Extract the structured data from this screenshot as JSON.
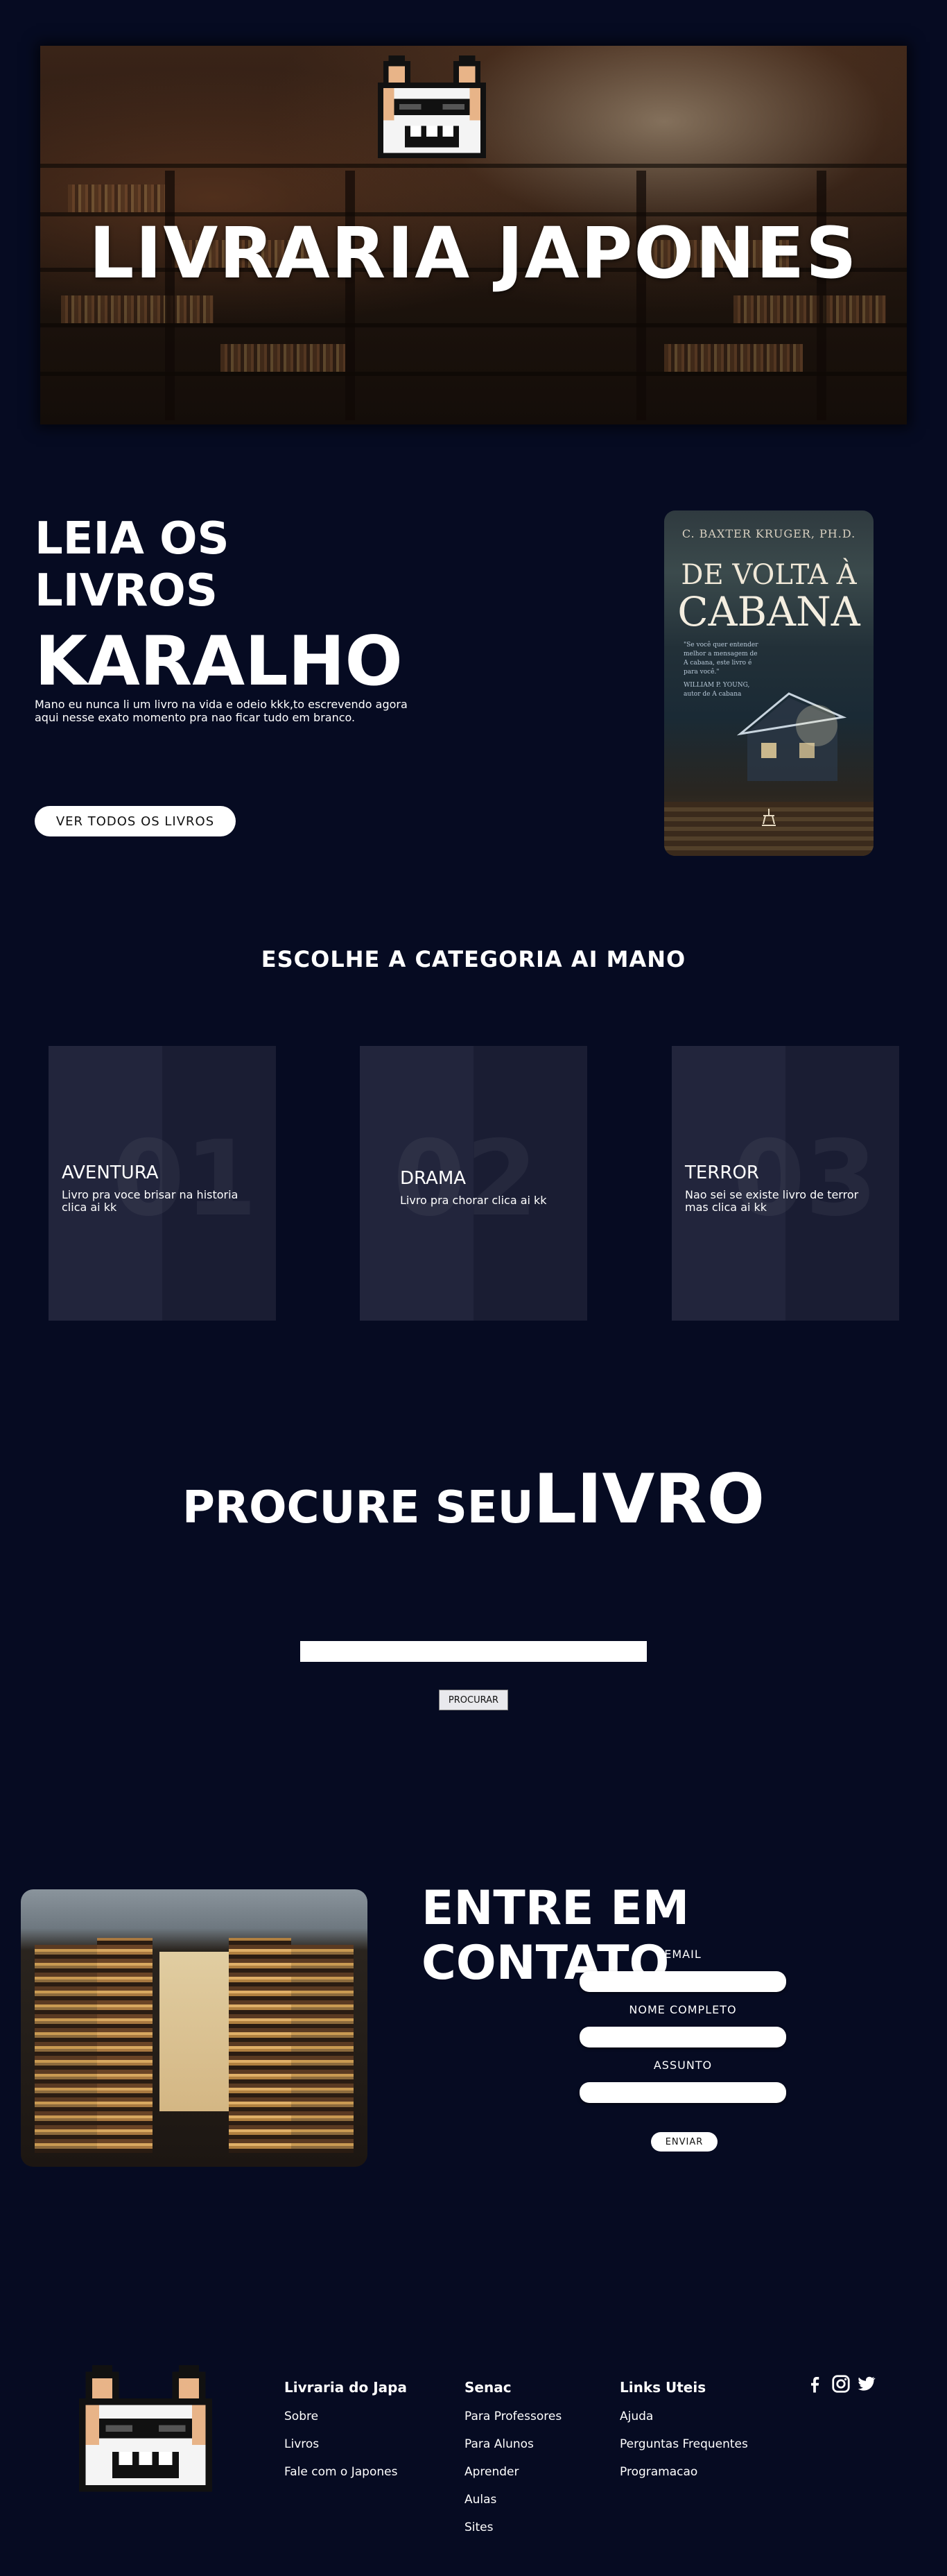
{
  "hero": {
    "title": "LIVRARIA JAPONES"
  },
  "intro": {
    "line1": "LEIA OS",
    "line2": "LIVROS",
    "line3": "KARALHO",
    "text": "Mano eu nunca li um livro na vida e odeio kkk,to escrevendo agora aqui nesse exato momento pra nao ficar tudo em branco.",
    "button_label": "VER TODOS OS LIVROS"
  },
  "book": {
    "author": "C. BAXTER KRUGER, PH.D.",
    "title_line1": "DE VOLTA À",
    "title_line2": "CABANA",
    "quote": "\"Se você quer entender melhor a mensagem de A cabana, este livro é para você.\"",
    "quote_author": "WILLIAM P. YOUNG, autor de A cabana"
  },
  "categories": {
    "heading": "ESCOLHE A CATEGORIA AI MANO",
    "items": [
      {
        "number": "01",
        "title": "AVENTURA",
        "description": "Livro pra voce brisar na historia clica ai kk"
      },
      {
        "number": "02",
        "title": "DRAMA",
        "description": "Livro pra chorar clica ai kk"
      },
      {
        "number": "03",
        "title": "TERROR",
        "description": "Nao sei se existe livro de terror mas clica ai kk"
      }
    ]
  },
  "search": {
    "title_small": "PROCURE SEU",
    "title_big": "LIVRO",
    "button_label": "PROCURAR",
    "input_value": ""
  },
  "contact": {
    "title": "ENTRE EM CONTATO",
    "email_label": "EMAIL",
    "name_label": "NOME COMPLETO",
    "subject_label": "ASSUNTO",
    "send_label": "ENVIAR"
  },
  "footer": {
    "col1": {
      "title": "Livraria do Japa",
      "links": [
        "Sobre",
        "Livros",
        "Fale com o Japones"
      ]
    },
    "col2": {
      "title": "Senac",
      "links": [
        "Para Professores",
        "Para Alunos",
        "Aprender",
        "Aulas",
        "Sites"
      ]
    },
    "col3": {
      "title": "Links Uteis",
      "links": [
        "Ajuda",
        "Perguntas Frequentes",
        "Programacao"
      ]
    },
    "social": [
      "facebook-icon",
      "instagram-icon",
      "twitter-icon"
    ]
  },
  "colors": {
    "background": "#060b22",
    "card": "#1a1d33",
    "card_half": "#22253c"
  }
}
